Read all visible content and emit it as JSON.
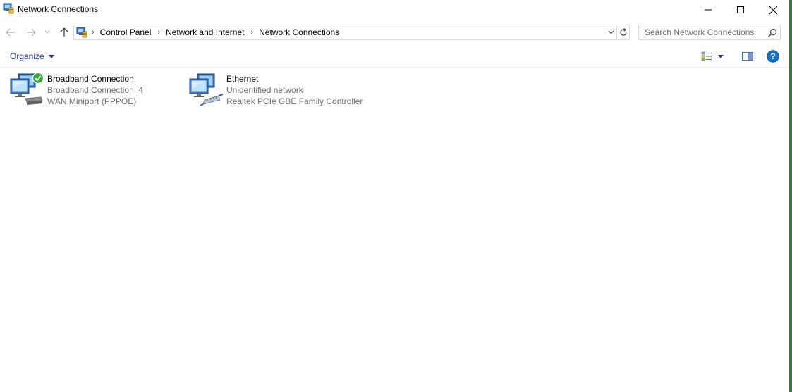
{
  "window": {
    "title": "Network Connections",
    "controls": {
      "minimize": "minimize-icon",
      "maximize": "maximize-icon",
      "close": "close-icon"
    }
  },
  "address": {
    "crumbs": [
      "Control Panel",
      "Network and Internet",
      "Network Connections"
    ]
  },
  "search": {
    "placeholder": "Search Network Connections",
    "value": ""
  },
  "toolbar": {
    "organize_label": "Organize"
  },
  "connections": [
    {
      "name": "Broadband Connection",
      "status": "Broadband Connection  4",
      "device": "WAN Miniport (PPPOE)",
      "connected": true
    },
    {
      "name": "Ethernet",
      "status": "Unidentified network",
      "device": "Realtek PCIe GBE Family Controller",
      "connected": false
    }
  ],
  "colors": {
    "accent": "#1e3287",
    "secondary_text": "#6d6d6d",
    "border": "#d9d9d9",
    "help_blue": "#1a6fc9",
    "status_green": "#3aa33a"
  }
}
